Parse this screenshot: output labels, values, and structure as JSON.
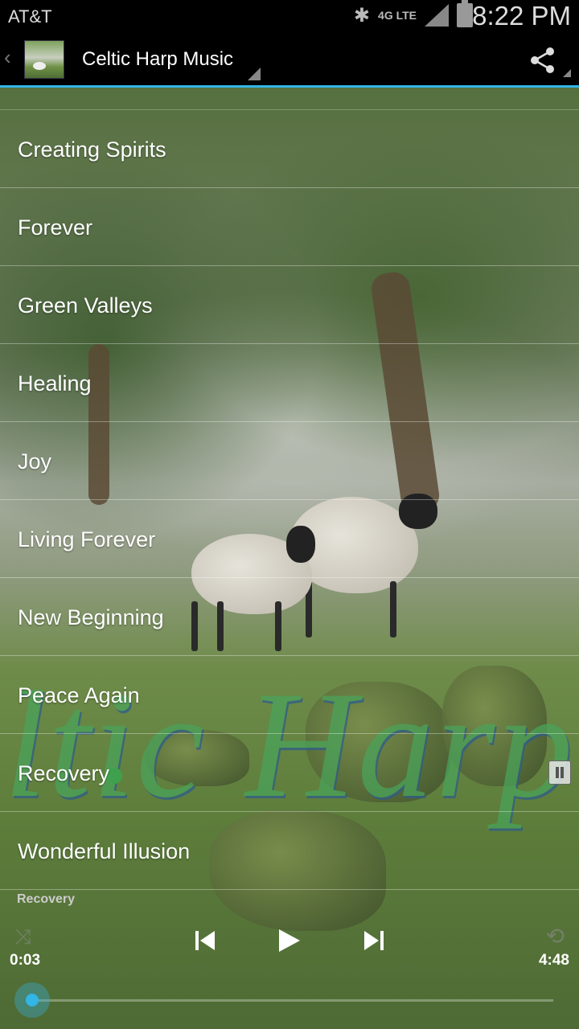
{
  "status_bar": {
    "carrier": "AT&T",
    "network": "4G LTE",
    "time": "8:22 PM"
  },
  "action_bar": {
    "title": "Celtic Harp Music",
    "icons": {
      "back": "chevron-left-icon",
      "share": "share-icon"
    }
  },
  "tracks": [
    "Creating Spirits",
    "Forever",
    "Green Valleys",
    "Healing",
    "Joy",
    "Living Forever",
    "New Beginning",
    "Peace Again",
    "Recovery",
    "Wonderful Illusion"
  ],
  "background_text": "ltic Harp",
  "player": {
    "now_playing": "Recovery",
    "elapsed": "0:03",
    "duration": "4:48",
    "progress_fraction": 0.01,
    "state": "playing",
    "icons": [
      "shuffle-icon",
      "previous-icon",
      "play-icon",
      "next-icon",
      "repeat-icon"
    ]
  },
  "colors": {
    "accent": "#33b5e5",
    "watermark": "#4aa35a"
  }
}
